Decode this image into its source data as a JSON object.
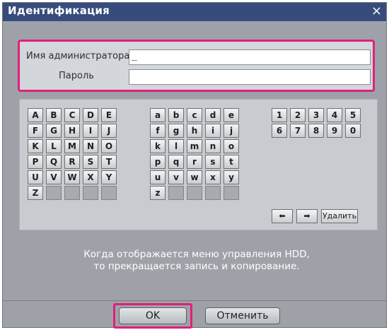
{
  "dialog": {
    "title": "Идентификация",
    "close_symbol": "×"
  },
  "credentials": {
    "admin_label": "Имя администратора",
    "admin_value": "_",
    "password_label": "Пароль",
    "password_value": ""
  },
  "keyboard": {
    "upper": [
      [
        "A",
        "B",
        "C",
        "D",
        "E"
      ],
      [
        "F",
        "G",
        "H",
        "I",
        "J"
      ],
      [
        "K",
        "L",
        "M",
        "N",
        "O"
      ],
      [
        "P",
        "Q",
        "R",
        "S",
        "T"
      ],
      [
        "U",
        "V",
        "W",
        "X",
        "Y"
      ],
      [
        "Z",
        "",
        "",
        "",
        ""
      ]
    ],
    "lower": [
      [
        "a",
        "b",
        "c",
        "d",
        "e"
      ],
      [
        "f",
        "g",
        "h",
        "i",
        "j"
      ],
      [
        "k",
        "l",
        "m",
        "n",
        "o"
      ],
      [
        "p",
        "q",
        "r",
        "s",
        "t"
      ],
      [
        "u",
        "v",
        "w",
        "x",
        "y"
      ],
      [
        "z",
        "",
        "",
        "",
        ""
      ]
    ],
    "digits": [
      [
        "1",
        "2",
        "3",
        "4",
        "5"
      ],
      [
        "6",
        "7",
        "8",
        "9",
        "0"
      ]
    ],
    "left_arrow": "⬅",
    "right_arrow": "➡",
    "delete_label": "Удалить"
  },
  "message": {
    "line1": "Когда отображается меню управления HDD,",
    "line2": "то прекращается запись и копирование."
  },
  "buttons": {
    "ok_label": "OK",
    "cancel_label": "Отменить"
  },
  "colors": {
    "titlebar": "#374c7d",
    "highlight": "#e0207c",
    "dialog_bg": "#9ea2a8"
  }
}
